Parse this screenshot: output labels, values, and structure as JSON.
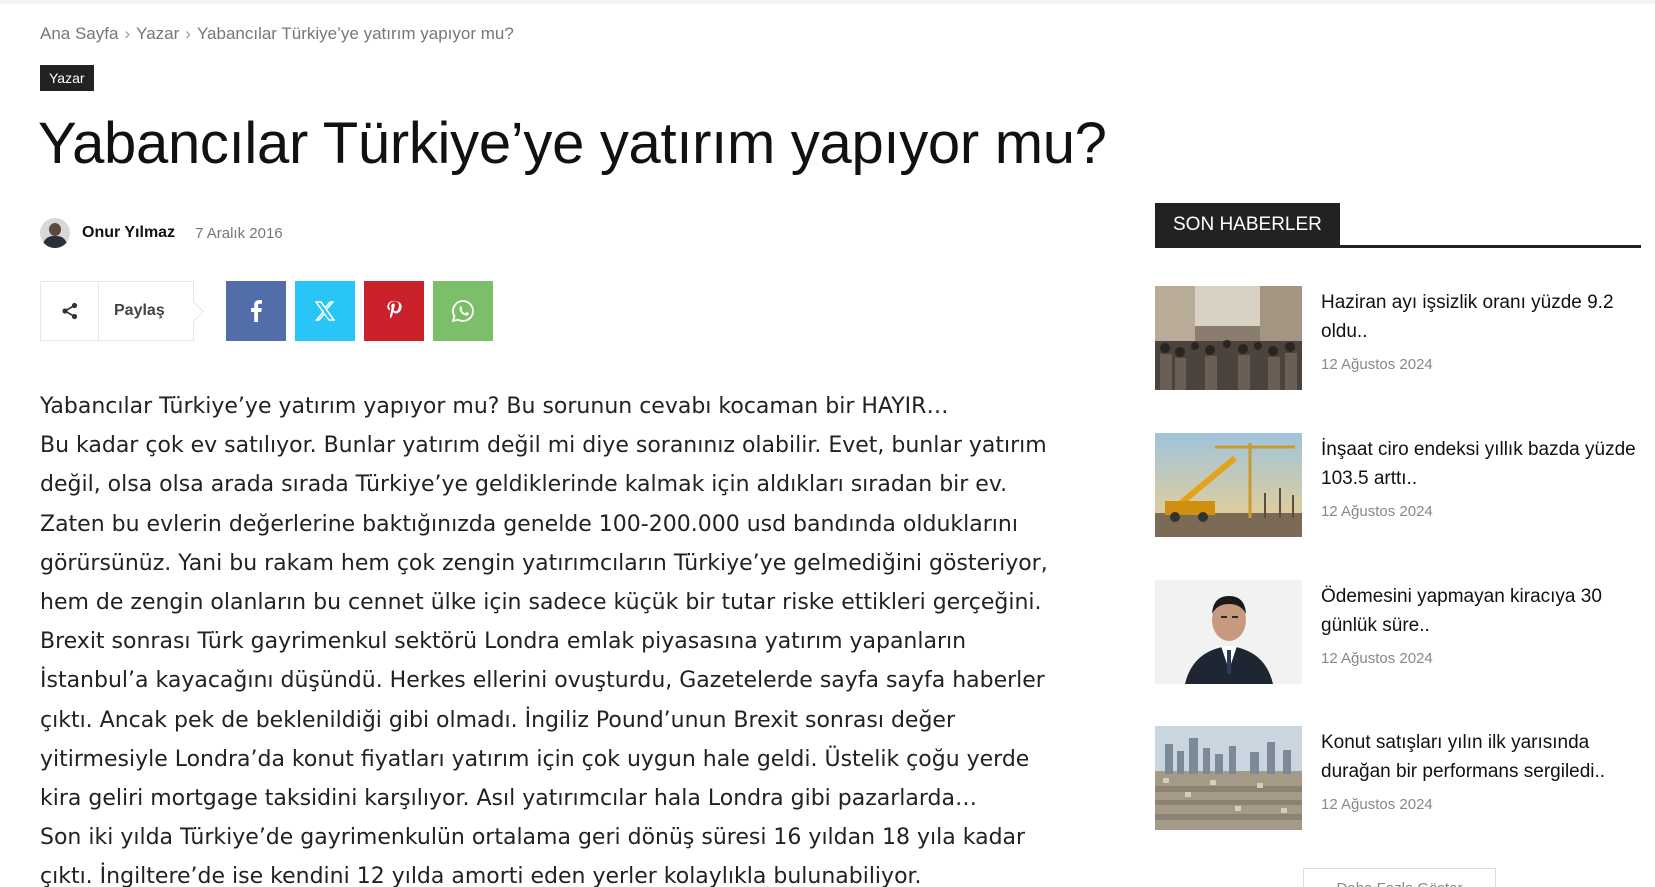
{
  "breadcrumb": {
    "home": "Ana Sayfa",
    "separator": "›",
    "category": "Yazar",
    "current": "Yabancılar Türkiye’ye yatırım yapıyor mu?"
  },
  "post": {
    "category_tag": "Yazar",
    "title": "Yabancılar Türkiye’ye yatırım yapıyor mu?",
    "author": "Onur Yılmaz",
    "date": "7 Aralık 2016"
  },
  "share": {
    "label": "Paylaş",
    "buttons": [
      {
        "network": "facebook",
        "icon": "facebook-icon",
        "color": "#516eab"
      },
      {
        "network": "x",
        "icon": "x-icon",
        "color": "#29c5f6"
      },
      {
        "network": "pinterest",
        "icon": "pinterest-icon",
        "color": "#ca212a"
      },
      {
        "network": "whatsapp",
        "icon": "whatsapp-icon",
        "color": "#7bbf6a"
      }
    ]
  },
  "article": {
    "lines": [
      "Yabancılar Türkiye’ye yatırım yapıyor mu? Bu sorunun cevabı kocaman bir HAYIR…",
      "Bu kadar çok ev satılıyor. Bunlar yatırım değil mi diye soranınız olabilir. Evet, bunlar yatırım",
      "değil, olsa olsa arada sırada Türkiye’ye geldiklerinde kalmak için aldıkları sıradan bir ev.",
      "Zaten bu evlerin değerlerine baktığınızda genelde 100-200.000 usd bandında olduklarını",
      "görürsünüz. Yani bu rakam hem çok zengin yatırımcıların Türkiye’ye gelmediğini gösteriyor,",
      "hem de zengin olanların bu cennet ülke için sadece küçük bir tutar riske ettikleri gerçeğini.",
      "Brexit sonrası Türk gayrimenkul sektörü Londra emlak piyasasına yatırım yapanların",
      "İstanbul’a kayacağını düşündü. Herkes ellerini ovuşturdu, Gazetelerde sayfa sayfa haberler",
      "çıktı. Ancak pek de beklenildiği gibi olmadı. İngiliz Pound’unun Brexit sonrası değer",
      "yitirmesiyle Londra’da konut fiyatları yatırım için çok uygun hale geldi. Üstelik çoğu yerde",
      "kira geliri mortgage taksidini karşılıyor. Asıl yatırımcılar hala Londra gibi pazarlarda…",
      "Son iki yılda Türkiye’de gayrimenkulün ortalama geri dönüş süresi 16 yıldan 18 yıla kadar",
      "çıktı. İngiltere’de ise kendini 12 yılda amorti eden yerler kolaylıkla bulunabiliyor."
    ]
  },
  "sidebar": {
    "heading": "SON HABERLER",
    "items": [
      {
        "title": "Haziran ayı işsizlik oranı yüzde 9.2 oldu..",
        "date": "12 Ağustos 2024",
        "thumb": "crowd-street"
      },
      {
        "title": "İnşaat ciro endeksi yıllık bazda yüzde 103.5 arttı..",
        "date": "12 Ağustos 2024",
        "thumb": "construction-crane"
      },
      {
        "title": "Ödemesini yapmayan kiracıya 30 günlük süre..",
        "date": "12 Ağustos 2024",
        "thumb": "man-portrait"
      },
      {
        "title": "Konut satışları yılın ilk yarısında durağan bir performans sergiledi..",
        "date": "12 Ağustos 2024",
        "thumb": "city-skyline"
      }
    ],
    "more_button": "Daha Fazla Göster"
  }
}
